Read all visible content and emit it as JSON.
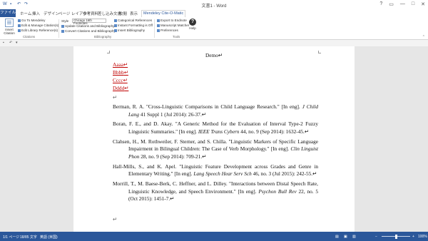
{
  "window": {
    "title": "文書1 - Word",
    "controls": [
      "?",
      "▭",
      "—",
      "□",
      "✕"
    ]
  },
  "tabs": [
    "ファイル",
    "ホーム",
    "挿入",
    "デザイン",
    "ページ レイアウト",
    "参考資料",
    "差し込み文書",
    "校閲",
    "表示",
    "Mendeley Cite-O-Matic"
  ],
  "active_tab": "Mendeley Cite-O-Matic",
  "ribbon": {
    "insert_citation": "Insert Citation",
    "go_to_mendeley": "Go To Mendeley",
    "edit_manage": "Edit & Manage Citation(s)",
    "edit_library": "Edit Library Reference(s)",
    "style_label": "Style",
    "style_value": "Chicago 16th Footnotes",
    "update_citations": "Update Citations and Bibliography",
    "convert_citations": "Convert Citations and Bibliography",
    "categorical_references": "Categorical References",
    "instant_formatting": "Instant Formatting is Off",
    "insert_bibliography": "Insert Bibliography",
    "export_to": "Export to Endnote",
    "manuscript_matcher": "Manuscript Matcher",
    "preferences": "Preferences",
    "help": "Help",
    "group_citations": "Citations",
    "group_bibliography": "Bibliography",
    "group_tools": "Tools"
  },
  "document": {
    "heading": "Demo",
    "items": [
      "Aaaa",
      "Bbbb",
      "Cccc",
      "Dddd"
    ],
    "references": [
      {
        "before": "Berman, R. A. \"Cross-Linguistic Comparisons in Child Language Research.\" [In eng]. ",
        "journal": "J Child Lang",
        "after": " 41 Suppl 1 (Jul 2014): 26-37."
      },
      {
        "before": "Boran, F. E., and D. Akay. \"A Generic Method for the Evaluation of Interval Type-2 Fuzzy Linguistic Summaries.\" [In eng]. ",
        "journal": "IEEE Trans Cybern",
        "after": " 44, no. 9 (Sep 2014): 1632-45."
      },
      {
        "before": "Clahsen, H., M. Rothweiler, F. Sterner, and S. Chilla. \"Linguistic Markers of Specific Language Impairment in Bilingual Children: The Case of Verb Morphology.\" [In eng]. ",
        "journal": "Clin Linguist Phon",
        "after": " 28, no. 9 (Sep 2014): 709-21."
      },
      {
        "before": "Hall-Mills, S., and K. Apel. \"Linguistic Feature Development across Grades and Genre in Elementary Writing.\" [In eng]. ",
        "journal": "Lang Speech Hear Serv Sch",
        "after": " 46, no. 3 (Jul 2015): 242-55."
      },
      {
        "before": "Morrill, T., M. Baese-Berk, C. Heffner, and L. Dilley. \"Interactions between Distal Speech Rate, Linguistic Knowledge, and Speech Environment.\" [In eng]. ",
        "journal": "Psychon Bull Rev",
        "after": " 22, no. 5 (Oct 2015): 1451-7."
      }
    ]
  },
  "status": {
    "page": "1/1 ページ",
    "words": "18/85 文字",
    "language": "英語 (米国)",
    "zoom": "100%",
    "zoom_fraction": 0.5
  },
  "colors": {
    "accent": "#2b579a",
    "heading_red": "#c00000"
  }
}
